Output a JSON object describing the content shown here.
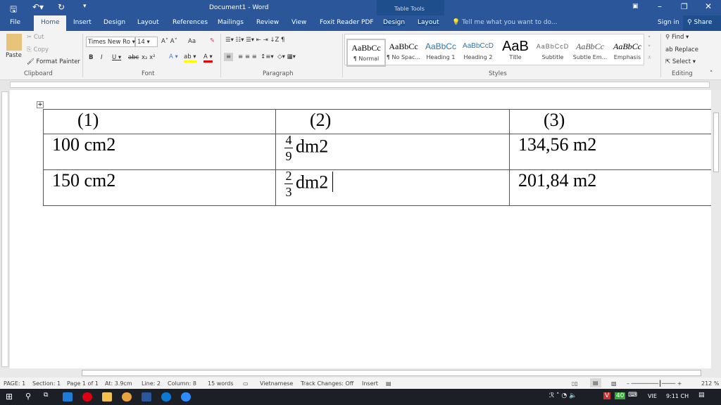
{
  "title": "Document1 - Word",
  "context_tab": "Table Tools",
  "tabs": [
    "File",
    "Home",
    "Insert",
    "Design",
    "Layout",
    "References",
    "Mailings",
    "Review",
    "View",
    "Foxit Reader PDF",
    "Design",
    "Layout"
  ],
  "tell_me": "Tell me what you want to do...",
  "sign_in": "Sign in",
  "share": "Share",
  "clipboard": {
    "paste": "Paste",
    "cut": "Cut",
    "copy": "Copy",
    "format_painter": "Format Painter",
    "label": "Clipboard"
  },
  "font": {
    "name": "Times New Ro",
    "size": "14",
    "label": "Font",
    "case": "Aa"
  },
  "paragraph": {
    "label": "Paragraph"
  },
  "styles": {
    "label": "Styles",
    "items": [
      {
        "preview": "AaBbCc",
        "name": "¶ Normal"
      },
      {
        "preview": "AaBbCc",
        "name": "¶ No Spac..."
      },
      {
        "preview": "AaBbCc",
        "name": "Heading 1"
      },
      {
        "preview": "AaBbCcD",
        "name": "Heading 2"
      },
      {
        "preview": "AaB",
        "name": "Title"
      },
      {
        "preview": "AaBbCcD",
        "name": "Subtitle"
      },
      {
        "preview": "AaBbCc",
        "name": "Subtle Em..."
      },
      {
        "preview": "AaBbCc",
        "name": "Emphasis"
      }
    ]
  },
  "editing": {
    "find": "Find",
    "replace": "Replace",
    "select": "Select",
    "label": "Editing"
  },
  "table": {
    "header": [
      "(1)",
      "(2)",
      "(3)"
    ],
    "rows": [
      {
        "c1": "100 cm2",
        "num": "4",
        "den": "9",
        "unit": "dm2",
        "c3": "134,56 m2"
      },
      {
        "c1": "150 cm2",
        "num": "2",
        "den": "3",
        "unit": "dm2",
        "c3": "201,84 m2"
      }
    ]
  },
  "status": {
    "page": "PAGE: 1",
    "section": "Section: 1",
    "pageof": "Page 1 of 1",
    "at": "At: 3.9cm",
    "line": "Line: 2",
    "column": "Column: 8",
    "words": "15 words",
    "lang": "Vietnamese",
    "track": "Track Changes: Off",
    "mode": "Insert",
    "zoom": "212 %"
  },
  "taskbar": {
    "lang": "VIE",
    "time": "9:11 CH",
    "battery": "40"
  }
}
